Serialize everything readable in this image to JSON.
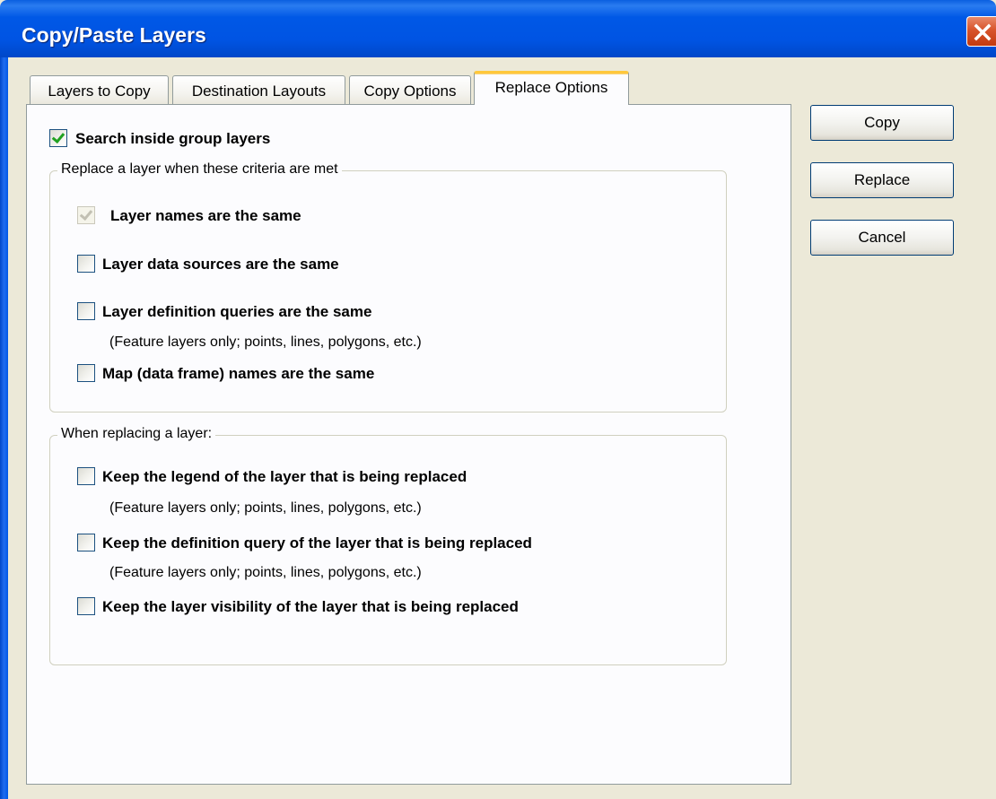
{
  "window": {
    "title": "Copy/Paste Layers"
  },
  "tabs": [
    {
      "label": "Layers to Copy",
      "active": false
    },
    {
      "label": "Destination Layouts",
      "active": false
    },
    {
      "label": "Copy Options",
      "active": false
    },
    {
      "label": "Replace Options",
      "active": true
    }
  ],
  "replace_options": {
    "search_inside_group": {
      "label": "Search inside group layers",
      "checked": true
    },
    "criteria_group": {
      "title": "Replace a layer when these criteria are met",
      "items": [
        {
          "label": "Layer names are the same",
          "checked": true,
          "enabled": false
        },
        {
          "label": "Layer data sources are the same",
          "checked": false
        },
        {
          "label": "Layer definition queries are the same",
          "checked": false,
          "note": "(Feature layers only; points, lines, polygons, etc.)"
        },
        {
          "label": "Map (data frame) names are the same",
          "checked": false
        }
      ]
    },
    "replacing_group": {
      "title": "When replacing a layer:",
      "items": [
        {
          "label": "Keep the legend of the layer that is being replaced",
          "checked": false,
          "note": "(Feature layers only; points, lines, polygons, etc.)"
        },
        {
          "label": "Keep the definition query of the layer that is being replaced",
          "checked": false,
          "note": "(Feature layers only; points, lines, polygons, etc.)"
        },
        {
          "label": "Keep the layer visibility of the layer that is being replaced",
          "checked": false
        }
      ]
    }
  },
  "buttons": {
    "copy": "Copy",
    "replace": "Replace",
    "cancel": "Cancel"
  },
  "colors": {
    "titlebar": "#0054e3",
    "window_bg": "#ece9d8",
    "active_tab_accent": "#ffc83c",
    "checkmark": "#21a121"
  }
}
